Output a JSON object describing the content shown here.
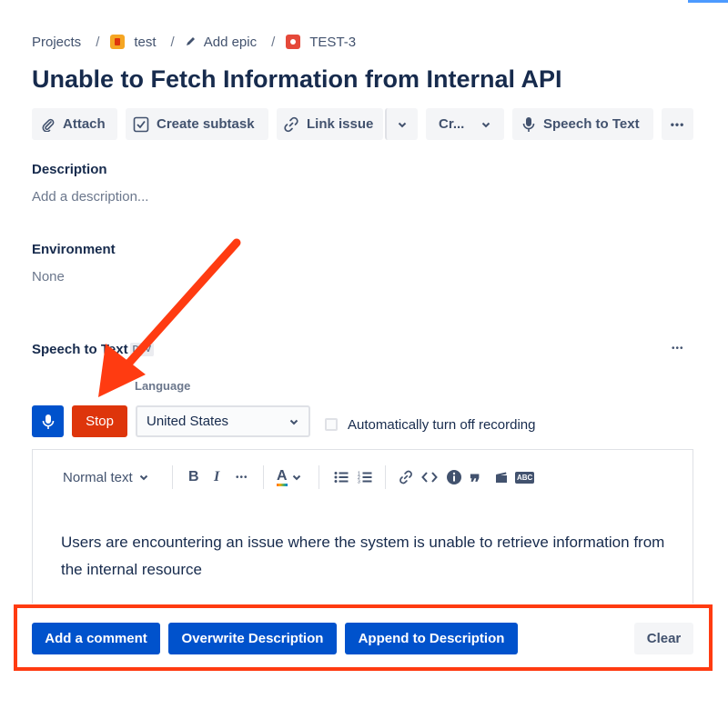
{
  "breadcrumb": {
    "projects": "Projects",
    "project": "test",
    "epic": "Add epic",
    "issue": "TEST-3"
  },
  "issue": {
    "title": "Unable to Fetch Information from Internal API"
  },
  "toolbar": {
    "attach": "Attach",
    "create_subtask": "Create subtask",
    "link_issue": "Link issue",
    "create_truncated": "Cr...",
    "speech_to_text": "Speech to Text",
    "more": "•••"
  },
  "description": {
    "label": "Description",
    "placeholder": "Add a description..."
  },
  "environment": {
    "label": "Environment",
    "value": "None"
  },
  "speech_panel": {
    "title": "Speech to Text",
    "badge": "DEV",
    "more": "•••",
    "language_label": "Language",
    "stop_label": "Stop",
    "language_value": "United States",
    "auto_off_label": "Automatically turn off recording",
    "auto_off_checked": false
  },
  "editor": {
    "text_style": "Normal text",
    "bold": "B",
    "italic": "I",
    "more": "•••",
    "text_color": "A",
    "abc": "ABC",
    "content": "Users are encountering an issue where the system is unable to retrieve information from the internal resource"
  },
  "actions": {
    "add_comment": "Add a comment",
    "overwrite": "Overwrite Description",
    "append": "Append to Description",
    "clear": "Clear"
  },
  "colors": {
    "primary": "#0052cc",
    "danger": "#de350b",
    "annotation": "#ff3b11",
    "text": "#172b4d"
  }
}
